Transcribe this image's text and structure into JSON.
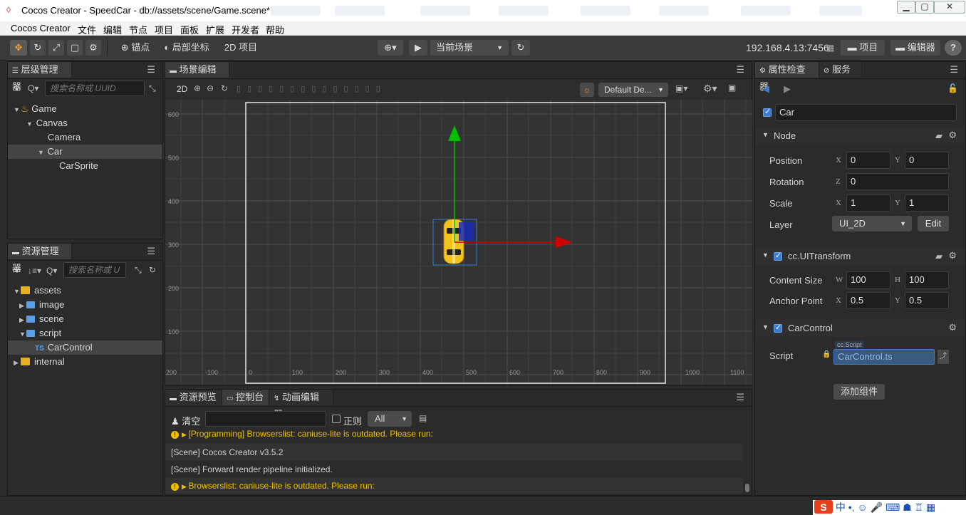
{
  "window": {
    "title": "Cocos Creator - SpeedCar - db://assets/scene/Game.scene*",
    "min_icon": "minimize-icon",
    "max_icon": "maximize-icon",
    "close_icon": "close-icon"
  },
  "menubar": {
    "items": [
      "Cocos Creator",
      "文件",
      "编辑",
      "节点",
      "项目",
      "面板",
      "扩展",
      "开发者",
      "帮助"
    ]
  },
  "toolbar": {
    "pivot_label": "锚点",
    "coord_label": "局部坐标",
    "mode_label": "2D 项目",
    "scene_select": "当前场景",
    "ip": "192.168.4.13:7456",
    "project_btn": "项目",
    "editor_btn": "编辑器",
    "help_btn": "?"
  },
  "hierarchy": {
    "tab": "层级管理器",
    "search_placeholder": "搜索名称或 UUID",
    "items": [
      {
        "label": "Game"
      },
      {
        "label": "Canvas"
      },
      {
        "label": "Camera"
      },
      {
        "label": "Car"
      },
      {
        "label": "CarSprite"
      }
    ]
  },
  "assets": {
    "tab": "资源管理器",
    "search_placeholder": "搜索名称或 U",
    "items": [
      {
        "label": "assets"
      },
      {
        "label": "image"
      },
      {
        "label": "scene"
      },
      {
        "label": "script"
      },
      {
        "label": "CarControl",
        "prefix": "TS"
      },
      {
        "label": "internal"
      }
    ]
  },
  "scene_editor": {
    "tab": "场景编辑器",
    "mode_2d": "2D",
    "design_select": "Default De...",
    "x_ticks": [
      "-200",
      "-100",
      "0",
      "100",
      "200",
      "300",
      "400",
      "500",
      "600",
      "700",
      "800",
      "900",
      "1000",
      "1100"
    ],
    "y_ticks": [
      "600",
      "500",
      "400",
      "300",
      "200",
      "100"
    ]
  },
  "bottom_tabs": {
    "tabs": [
      "资源预览",
      "控制台",
      "动画编辑器"
    ],
    "clear_label": "清空",
    "regex_label": "正则",
    "filter_select": "All"
  },
  "console": {
    "rows": [
      {
        "type": "warn",
        "text": "[Programming] Browserslist: caniuse-lite is outdated. Please run:"
      },
      {
        "type": "log",
        "text": "[Scene] Cocos Creator v3.5.2"
      },
      {
        "type": "log",
        "text": "[Scene] Forward render pipeline initialized."
      },
      {
        "type": "warn",
        "text": "Browserslist: caniuse-lite is outdated. Please run:"
      }
    ]
  },
  "inspector": {
    "tabs": [
      "属性检查器",
      "服务"
    ],
    "node_name": "Car",
    "node_section": "Node",
    "position_label": "Position",
    "position_x": "0",
    "position_y": "0",
    "rotation_label": "Rotation",
    "rotation_z": "0",
    "scale_label": "Scale",
    "scale_x": "1",
    "scale_y": "1",
    "layer_label": "Layer",
    "layer_value": "UI_2D",
    "edit_btn": "Edit",
    "uitransform_section": "cc.UITransform",
    "content_size_label": "Content Size",
    "content_w": "100",
    "content_h": "100",
    "anchor_label": "Anchor Point",
    "anchor_x": "0.5",
    "anchor_y": "0.5",
    "carcontrol_section": "CarControl",
    "script_label": "Script",
    "script_type": "cc.Script",
    "script_value": "CarControl.ts",
    "add_component_btn": "添加组件",
    "axis_x": "X",
    "axis_y": "Y",
    "axis_z": "Z",
    "axis_w": "W",
    "axis_h": "H"
  },
  "ime": {
    "label": "中"
  },
  "colors": {
    "accent_blue": "#3b7bd0",
    "warn_yellow": "#f0c000",
    "gizmo_green": "#00c000",
    "gizmo_red": "#d00000"
  }
}
